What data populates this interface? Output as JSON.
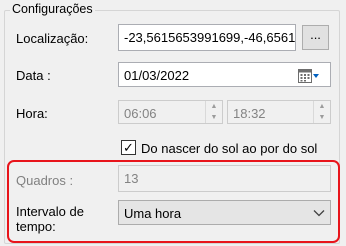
{
  "group": {
    "title": "Configurações"
  },
  "location": {
    "label": "Localização:",
    "value": "-23,5615653991699,-46,6561",
    "browse_label": "..."
  },
  "date": {
    "label": "Data :",
    "value": "01/03/2022"
  },
  "time": {
    "label": "Hora:",
    "start": "06:06",
    "end": "18:32"
  },
  "sunrise_sunset": {
    "label": "Do nascer do sol ao por do sol",
    "checked": true
  },
  "frames": {
    "label": "Quadros :",
    "value": "13"
  },
  "interval": {
    "label_line1": "Intervalo de",
    "label_line2": "tempo:",
    "selected": "Uma hora"
  },
  "colors": {
    "highlight": "#e8141b",
    "accent": "#0078d7"
  },
  "icons": [
    "calendar-icon",
    "chevron-down-icon",
    "spin-up-icon",
    "spin-down-icon",
    "checkmark-icon"
  ]
}
